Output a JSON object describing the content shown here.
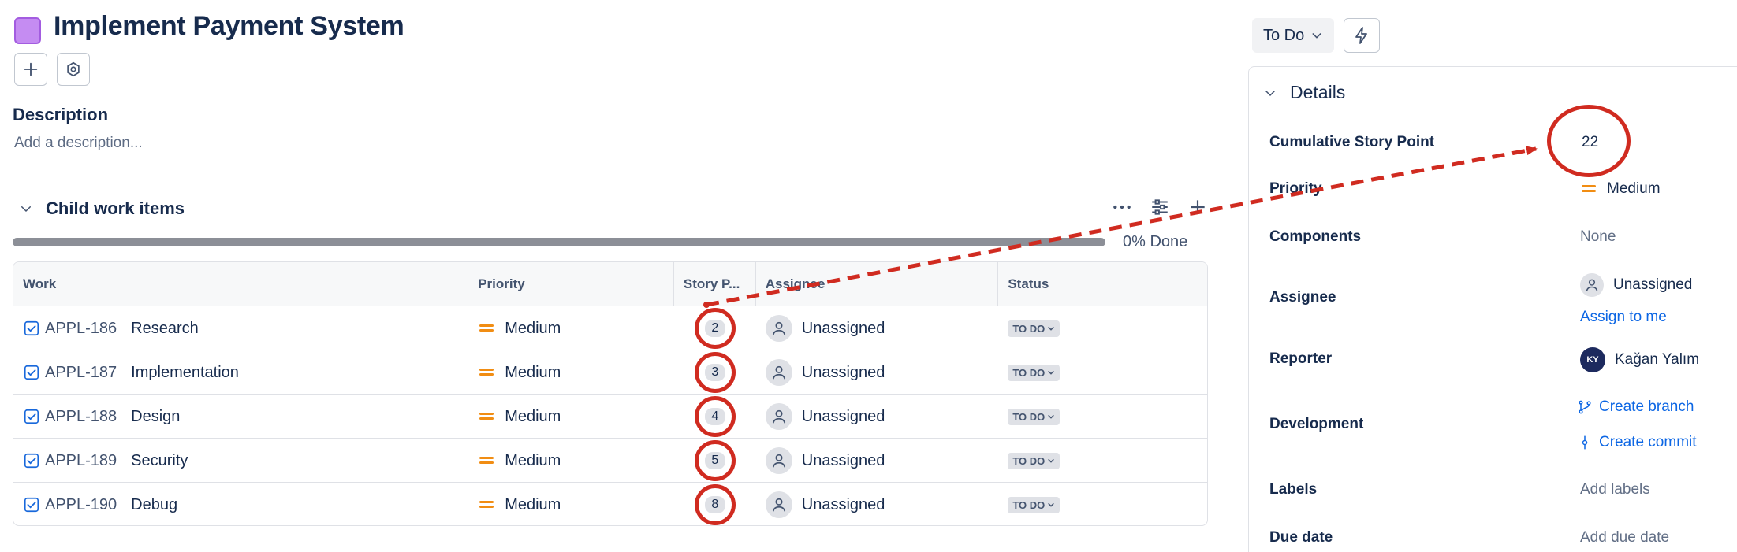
{
  "issue": {
    "title": "Implement Payment System",
    "description_heading": "Description",
    "description_placeholder": "Add a description..."
  },
  "child_items": {
    "heading": "Child work items",
    "progress_label": "0% Done",
    "progress_fraction": 0,
    "columns": [
      "Work",
      "Priority",
      "Story P...",
      "Assignee",
      "Status"
    ],
    "rows": [
      {
        "key": "APPL-186",
        "summary": "Research",
        "priority": "Medium",
        "story_points": "2",
        "assignee": "Unassigned",
        "status": "TO DO"
      },
      {
        "key": "APPL-187",
        "summary": "Implementation",
        "priority": "Medium",
        "story_points": "3",
        "assignee": "Unassigned",
        "status": "TO DO"
      },
      {
        "key": "APPL-188",
        "summary": "Design",
        "priority": "Medium",
        "story_points": "4",
        "assignee": "Unassigned",
        "status": "TO DO"
      },
      {
        "key": "APPL-189",
        "summary": "Security",
        "priority": "Medium",
        "story_points": "5",
        "assignee": "Unassigned",
        "status": "TO DO"
      },
      {
        "key": "APPL-190",
        "summary": "Debug",
        "priority": "Medium",
        "story_points": "8",
        "assignee": "Unassigned",
        "status": "TO DO"
      }
    ]
  },
  "status_button": "To Do",
  "details": {
    "heading": "Details",
    "cumulative_label": "Cumulative Story Point",
    "cumulative_value": "22",
    "priority_label": "Priority",
    "priority_value": "Medium",
    "components_label": "Components",
    "components_value": "None",
    "assignee_label": "Assignee",
    "assignee_value": "Unassigned",
    "assign_to_me": "Assign to me",
    "reporter_label": "Reporter",
    "reporter_initials": "KY",
    "reporter_value": "Kağan Yalım",
    "development_label": "Development",
    "create_branch": "Create branch",
    "create_commit": "Create commit",
    "labels_label": "Labels",
    "labels_value": "Add labels",
    "due_label": "Due date",
    "due_value": "Add due date"
  },
  "colors": {
    "annotation_red": "#d02b20",
    "priority_orange": "#f18d13",
    "link_blue": "#0c66e4",
    "epic_purple": "#c58cf2"
  }
}
